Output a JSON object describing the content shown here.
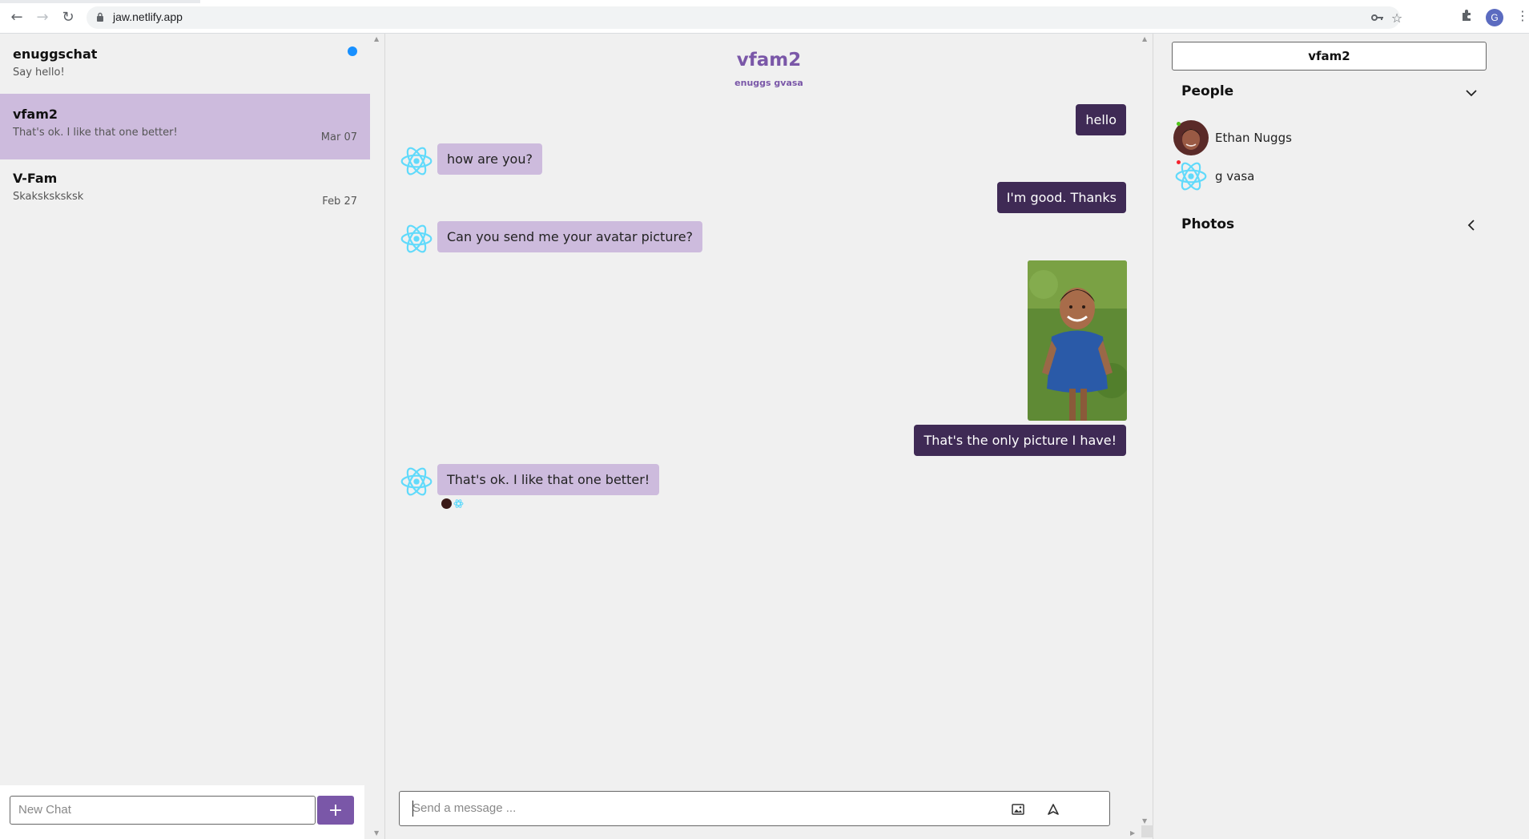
{
  "browser": {
    "url": "jaw.netlify.app",
    "profile_initial": "G"
  },
  "sidebar": {
    "chats": [
      {
        "title": "enuggschat",
        "subtitle": "Say hello!",
        "date": "",
        "unread": true,
        "active": false
      },
      {
        "title": "vfam2",
        "subtitle": "That's ok. I like that one better!",
        "date": "Mar 07",
        "unread": false,
        "active": true
      },
      {
        "title": "V-Fam",
        "subtitle": "Skaksksksksk",
        "date": "Feb 27",
        "unread": false,
        "active": false
      }
    ],
    "new_chat_placeholder": "New Chat",
    "new_chat_button": "+"
  },
  "chat": {
    "title": "vfam2",
    "members": "enuggs gvasa",
    "messages": [
      {
        "direction": "out",
        "text": "hello"
      },
      {
        "direction": "in",
        "text": "how are you?"
      },
      {
        "direction": "out",
        "text": "I'm good. Thanks"
      },
      {
        "direction": "in",
        "text": "Can you send me your avatar picture?"
      },
      {
        "direction": "out",
        "type": "image"
      },
      {
        "direction": "out",
        "text": "That's the only picture I have!"
      },
      {
        "direction": "in",
        "text": "That's ok. I like that one better!"
      }
    ],
    "message_placeholder": "Send a message ..."
  },
  "settings": {
    "chat_name": "vfam2",
    "people_heading": "People",
    "people": [
      {
        "name": "Ethan Nuggs",
        "online": true
      },
      {
        "name": "g vasa",
        "online": false
      }
    ],
    "photos_heading": "Photos"
  },
  "colors": {
    "accent": "#7a57a8",
    "outgoing_bubble": "#3f2a55",
    "incoming_bubble": "#cdbbdd",
    "unread_dot": "#1890ff"
  }
}
